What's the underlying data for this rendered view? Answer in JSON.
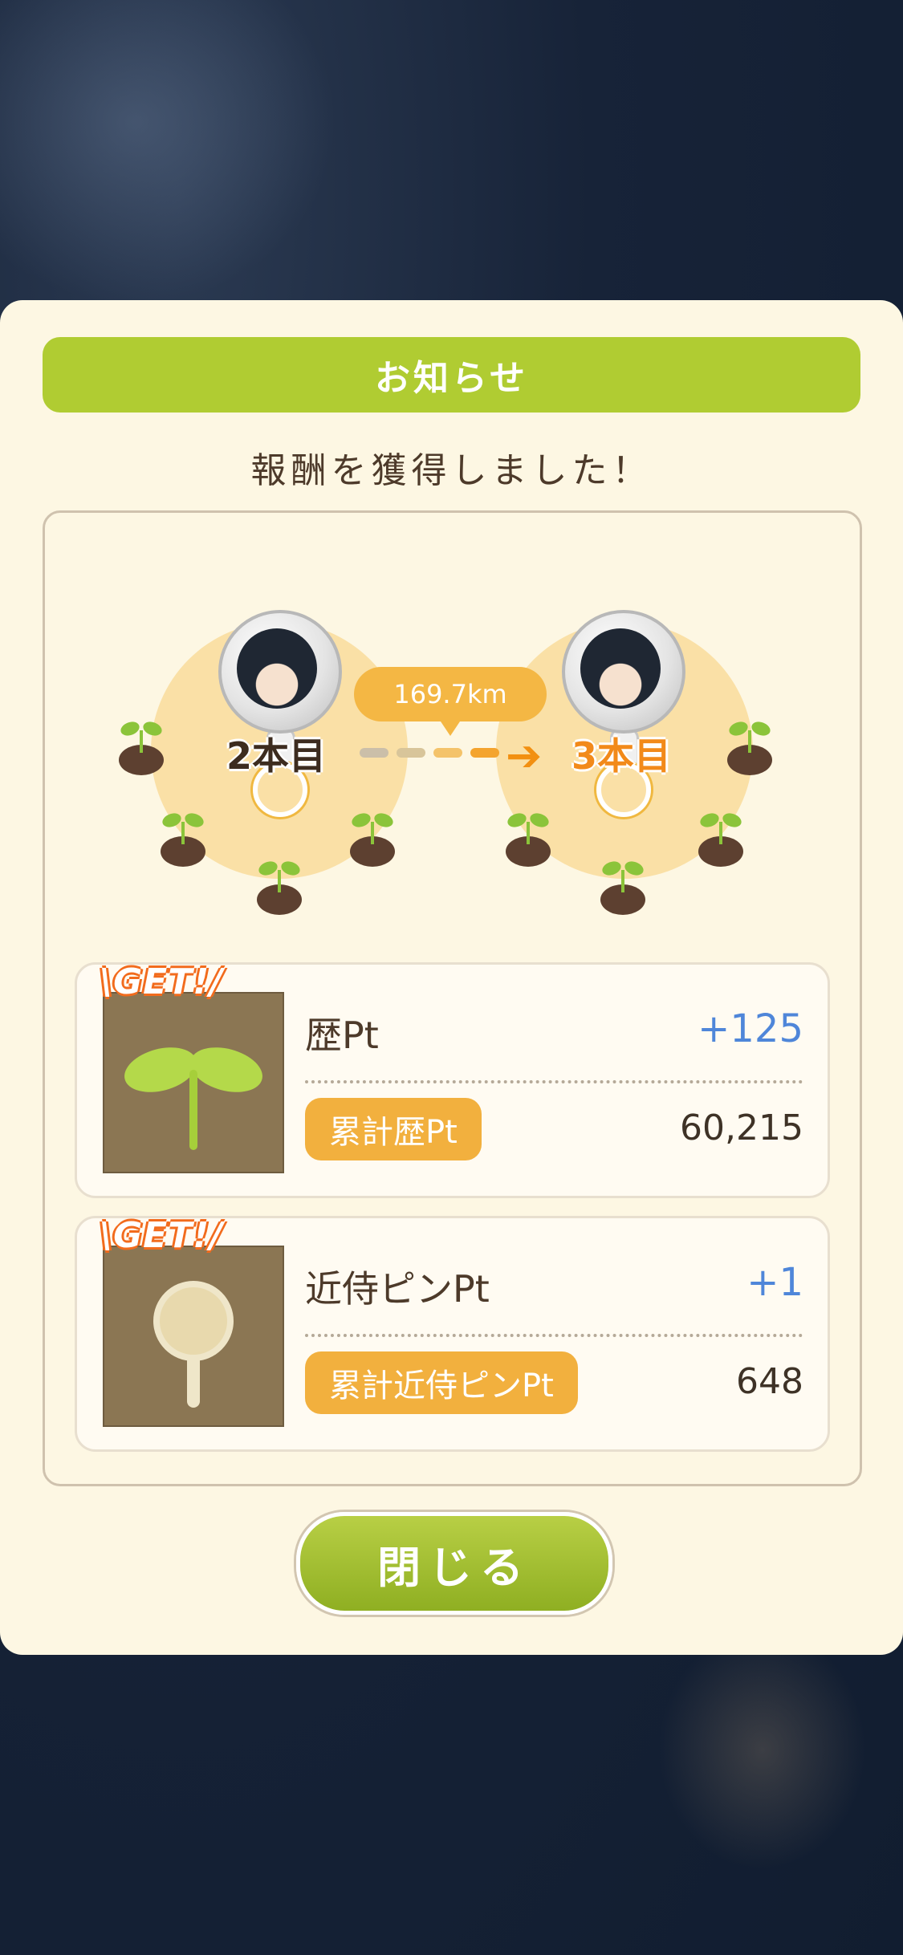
{
  "dialog": {
    "title": "お知らせ",
    "subtitle": "報酬を獲得しました！"
  },
  "progress": {
    "distance": "169.7km",
    "from_label": "2本目",
    "to_label": "3本目"
  },
  "rewards": [
    {
      "badge": "\\GET!/",
      "icon": "sprout-icon",
      "name": "歴Pt",
      "delta": "+125",
      "total_label": "累計歴Pt",
      "total_value": "60,215"
    },
    {
      "badge": "\\GET!/",
      "icon": "pin-icon",
      "name": "近侍ピンPt",
      "delta": "+1",
      "total_label": "累計近侍ピンPt",
      "total_value": "648"
    }
  ],
  "close_button": "閉じる",
  "colors": {
    "accent_green": "#b0cc32",
    "accent_orange": "#f2b03e",
    "delta_blue": "#4f86d9",
    "panel_bg": "#fdf7e3"
  }
}
